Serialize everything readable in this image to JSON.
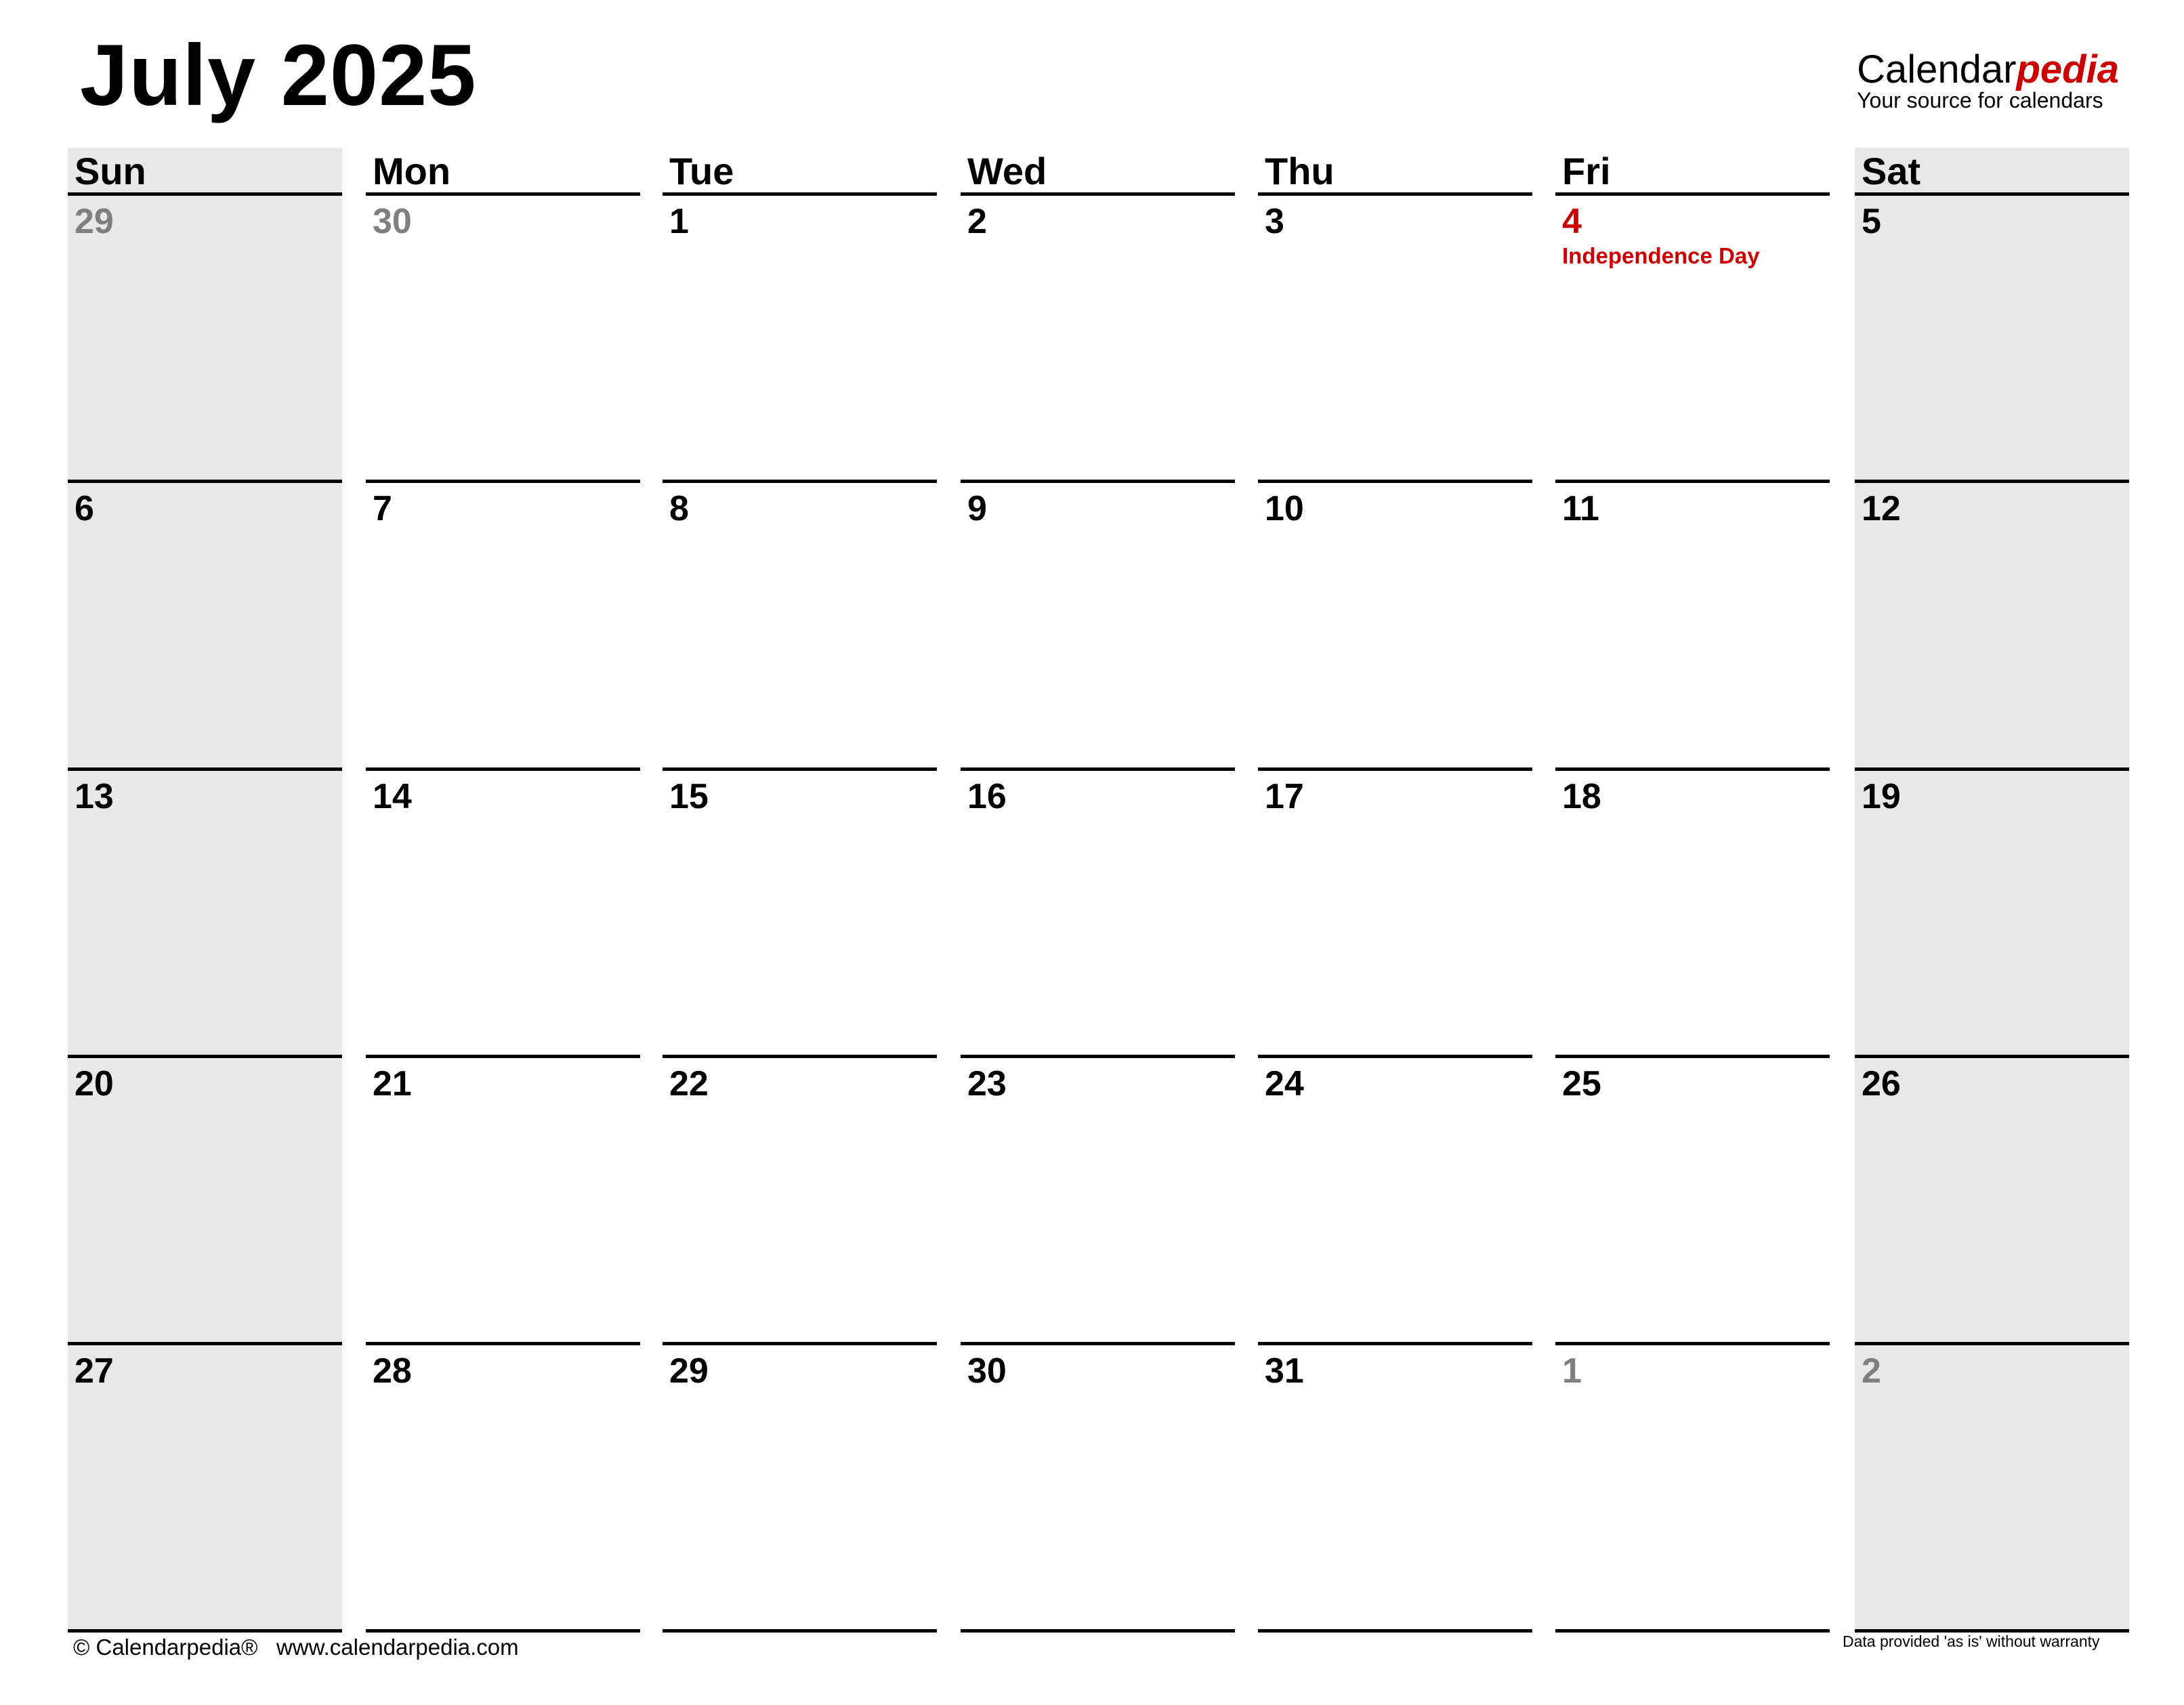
{
  "header": {
    "title": "July 2025",
    "brand_name_plain": "Calendar",
    "brand_name_accent": "pedia",
    "brand_tagline": "Your source for calendars"
  },
  "colors": {
    "weekend_shade": "#e8e8e8",
    "other_month_text": "#7f7f7f",
    "holiday_text": "#cc0000",
    "brand_accent": "#cc0000"
  },
  "weekdays": [
    "Sun",
    "Mon",
    "Tue",
    "Wed",
    "Thu",
    "Fri",
    "Sat"
  ],
  "weeks": [
    [
      {
        "day": "29",
        "type": "other"
      },
      {
        "day": "30",
        "type": "other"
      },
      {
        "day": "1",
        "type": "current"
      },
      {
        "day": "2",
        "type": "current"
      },
      {
        "day": "3",
        "type": "current"
      },
      {
        "day": "4",
        "type": "holiday",
        "label": "Independence Day"
      },
      {
        "day": "5",
        "type": "current"
      }
    ],
    [
      {
        "day": "6",
        "type": "current"
      },
      {
        "day": "7",
        "type": "current"
      },
      {
        "day": "8",
        "type": "current"
      },
      {
        "day": "9",
        "type": "current"
      },
      {
        "day": "10",
        "type": "current"
      },
      {
        "day": "11",
        "type": "current"
      },
      {
        "day": "12",
        "type": "current"
      }
    ],
    [
      {
        "day": "13",
        "type": "current"
      },
      {
        "day": "14",
        "type": "current"
      },
      {
        "day": "15",
        "type": "current"
      },
      {
        "day": "16",
        "type": "current"
      },
      {
        "day": "17",
        "type": "current"
      },
      {
        "day": "18",
        "type": "current"
      },
      {
        "day": "19",
        "type": "current"
      }
    ],
    [
      {
        "day": "20",
        "type": "current"
      },
      {
        "day": "21",
        "type": "current"
      },
      {
        "day": "22",
        "type": "current"
      },
      {
        "day": "23",
        "type": "current"
      },
      {
        "day": "24",
        "type": "current"
      },
      {
        "day": "25",
        "type": "current"
      },
      {
        "day": "26",
        "type": "current"
      }
    ],
    [
      {
        "day": "27",
        "type": "current"
      },
      {
        "day": "28",
        "type": "current"
      },
      {
        "day": "29",
        "type": "current"
      },
      {
        "day": "30",
        "type": "current"
      },
      {
        "day": "31",
        "type": "current"
      },
      {
        "day": "1",
        "type": "other"
      },
      {
        "day": "2",
        "type": "other"
      }
    ]
  ],
  "footer": {
    "copyright": "© Calendarpedia®   www.calendarpedia.com",
    "disclaimer": "Data provided 'as is' without warranty"
  }
}
